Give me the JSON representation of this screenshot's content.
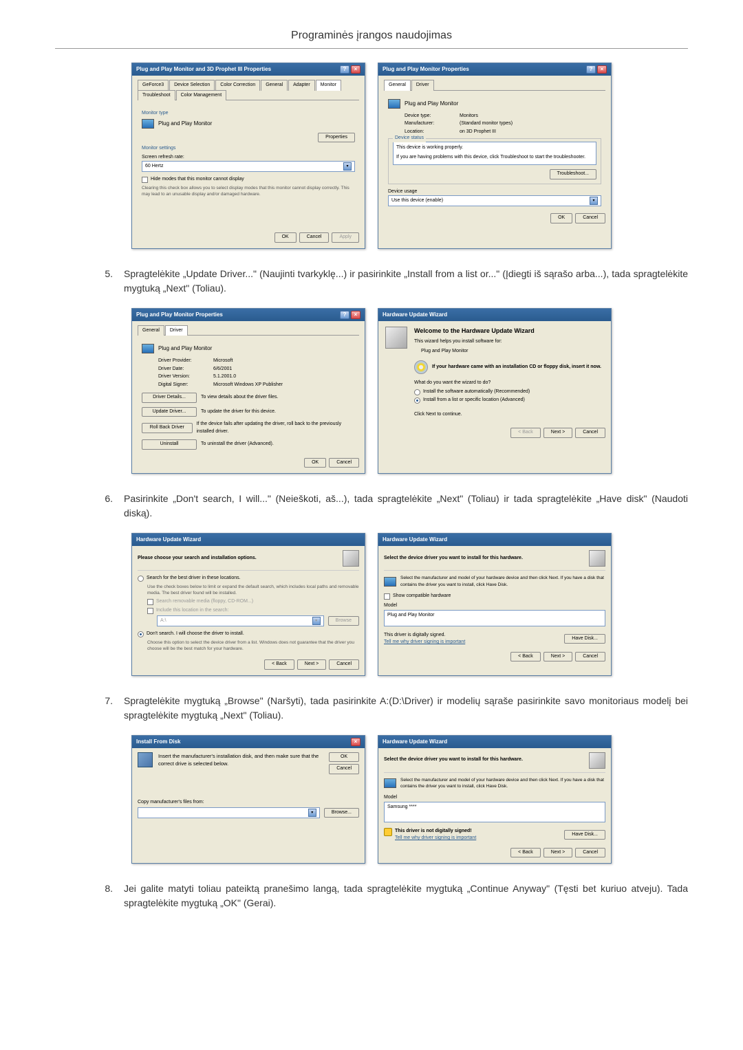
{
  "page_title": "Programinės įrangos naudojimas",
  "steps": {
    "s5": {
      "num": "5.",
      "text": "Spragtelėkite „Update Driver...\" (Naujinti tvarkyklę...) ir pasirinkite „Install from a list or...\" (Įdiegti iš sąrašo arba...), tada spragtelėkite mygtuką „Next\" (Toliau)."
    },
    "s6": {
      "num": "6.",
      "text": "Pasirinkite „Don't search, I will...\" (Neieškoti, aš...), tada spragtelėkite „Next\" (Toliau) ir tada spragtelėkite „Have disk\" (Naudoti diską)."
    },
    "s7": {
      "num": "7.",
      "text": "Spragtelėkite mygtuką „Browse\" (Naršyti), tada pasirinkite A:(D:\\Driver) ir modelių sąraše pasirinkite savo monitoriaus modelį bei spragtelėkite mygtuką „Next\" (Toliau)."
    },
    "s8": {
      "num": "8.",
      "text": "Jei galite matyti toliau pateiktą pranešimo langą, tada spragtelėkite mygtuką „Continue Anyway\" (Tęsti bet kuriuo atveju). Tada spragtelėkite mygtuką „OK\" (Gerai)."
    }
  },
  "dlg1": {
    "title": "Plug and Play Monitor and 3D Prophet III Properties",
    "tabs": [
      "GeForce3",
      "Device Selection",
      "Color Correction",
      "General",
      "Adapter",
      "Monitor",
      "Troubleshoot",
      "Color Management"
    ],
    "monitor_type_label": "Monitor type",
    "monitor_name": "Plug and Play Monitor",
    "properties_btn": "Properties",
    "settings_label": "Monitor settings",
    "refresh_label": "Screen refresh rate:",
    "refresh_value": "60 Hertz",
    "hide_modes": "Hide modes that this monitor cannot display",
    "hide_modes_desc": "Clearing this check box allows you to select display modes that this monitor cannot display correctly. This may lead to an unusable display and/or damaged hardware.",
    "ok": "OK",
    "cancel": "Cancel",
    "apply": "Apply"
  },
  "dlg2": {
    "title": "Plug and Play Monitor Properties",
    "tabs": [
      "General",
      "Driver"
    ],
    "monitor_name": "Plug and Play Monitor",
    "dev_type_l": "Device type:",
    "dev_type_v": "Monitors",
    "manuf_l": "Manufacturer:",
    "manuf_v": "(Standard monitor types)",
    "loc_l": "Location:",
    "loc_v": "on 3D Prophet III",
    "status_label": "Device status",
    "status_text": "This device is working properly.",
    "status_hint": "If you are having problems with this device, click Troubleshoot to start the troubleshooter.",
    "troubleshoot": "Troubleshoot...",
    "usage_label": "Device usage",
    "usage_value": "Use this device (enable)",
    "ok": "OK",
    "cancel": "Cancel"
  },
  "dlg3": {
    "title": "Plug and Play Monitor Properties",
    "tabs": [
      "General",
      "Driver"
    ],
    "monitor_name": "Plug and Play Monitor",
    "provider_l": "Driver Provider:",
    "provider_v": "Microsoft",
    "date_l": "Driver Date:",
    "date_v": "6/6/2001",
    "version_l": "Driver Version:",
    "version_v": "5.1.2001.0",
    "signer_l": "Digital Signer:",
    "signer_v": "Microsoft Windows XP Publisher",
    "details_btn": "Driver Details...",
    "details_txt": "To view details about the driver files.",
    "update_btn": "Update Driver...",
    "update_txt": "To update the driver for this device.",
    "rollback_btn": "Roll Back Driver",
    "rollback_txt": "If the device fails after updating the driver, roll back to the previously installed driver.",
    "uninstall_btn": "Uninstall",
    "uninstall_txt": "To uninstall the driver (Advanced).",
    "ok": "OK",
    "cancel": "Cancel"
  },
  "dlg4": {
    "title": "Hardware Update Wizard",
    "welcome": "Welcome to the Hardware Update Wizard",
    "helps": "This wizard helps you install software for:",
    "device": "Plug and Play Monitor",
    "cd_hint": "If your hardware came with an installation CD or floppy disk, insert it now.",
    "question": "What do you want the wizard to do?",
    "opt1": "Install the software automatically (Recommended)",
    "opt2": "Install from a list or specific location (Advanced)",
    "next_hint": "Click Next to continue.",
    "back": "< Back",
    "next": "Next >",
    "cancel": "Cancel"
  },
  "dlg5": {
    "title": "Hardware Update Wizard",
    "heading": "Please choose your search and installation options.",
    "opt_search": "Search for the best driver in these locations.",
    "opt_search_desc": "Use the check boxes below to limit or expand the default search, which includes local paths and removable media. The best driver found will be installed.",
    "chk_removable": "Search removable media (floppy, CD-ROM...)",
    "chk_location": "Include this location in the search:",
    "path_value": "A:\\",
    "browse": "Browse",
    "opt_nosrch": "Don't search. I will choose the driver to install.",
    "opt_nosrch_desc": "Choose this option to select the device driver from a list. Windows does not guarantee that the driver you choose will be the best match for your hardware.",
    "back": "< Back",
    "next": "Next >",
    "cancel": "Cancel"
  },
  "dlg6": {
    "title": "Hardware Update Wizard",
    "heading": "Select the device driver you want to install for this hardware.",
    "desc": "Select the manufacturer and model of your hardware device and then click Next. If you have a disk that contains the driver you want to install, click Have Disk.",
    "chk_compat": "Show compatible hardware",
    "model_l": "Model",
    "model_item": "Plug and Play Monitor",
    "signed": "This driver is digitally signed.",
    "sign_link": "Tell me why driver signing is important",
    "have_disk": "Have Disk...",
    "back": "< Back",
    "next": "Next >",
    "cancel": "Cancel"
  },
  "dlg7": {
    "title": "Install From Disk",
    "instruction": "Insert the manufacturer's installation disk, and then make sure that the correct drive is selected below.",
    "copy_label": "Copy manufacturer's files from:",
    "ok": "OK",
    "cancel": "Cancel",
    "browse": "Browse..."
  },
  "dlg8": {
    "title": "Hardware Update Wizard",
    "heading": "Select the device driver you want to install for this hardware.",
    "desc": "Select the manufacturer and model of your hardware device and then click Next. If you have a disk that contains the driver you want to install, click Have Disk.",
    "model_l": "Model",
    "model_item": "Samsung ****",
    "not_signed": "This driver is not digitally signed!",
    "sign_link": "Tell me why driver signing is important",
    "have_disk": "Have Disk...",
    "back": "< Back",
    "next": "Next >",
    "cancel": "Cancel"
  }
}
